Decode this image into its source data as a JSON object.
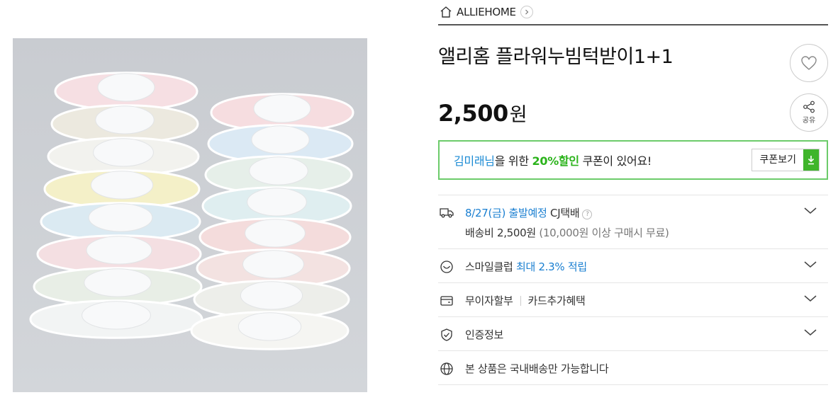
{
  "store": {
    "name": "ALLIEHOME"
  },
  "product": {
    "title": "앨리홈 플라워누빔턱받이1+1",
    "price": "2,500",
    "price_unit": "원",
    "share_label": "공유"
  },
  "coupon": {
    "user": "김미래님",
    "mid": "을 위한 ",
    "discount": "20%할인",
    "tail": " 쿠폰이 있어요!",
    "button": "쿠폰보기"
  },
  "delivery": {
    "date": "8/27(금) 출발예정",
    "carrier": "CJ택배",
    "help": "?",
    "fee_label": "배송비 2,500원",
    "fee_note": "(10,000원 이상 구매시 무료)"
  },
  "smileclub": {
    "label": "스마일클럽",
    "benefit": "최대 2.3% 적립"
  },
  "installment": {
    "label": "무이자할부",
    "extra": "카드추가혜택"
  },
  "certification": {
    "label": "인증정보"
  },
  "shipping_scope": {
    "label": "본 상품은 국내배송만 가능합니다"
  },
  "colors": {
    "accent_green": "#2bb31b",
    "link_blue": "#1a7fd1",
    "coupon_border": "#6ccb6a"
  }
}
